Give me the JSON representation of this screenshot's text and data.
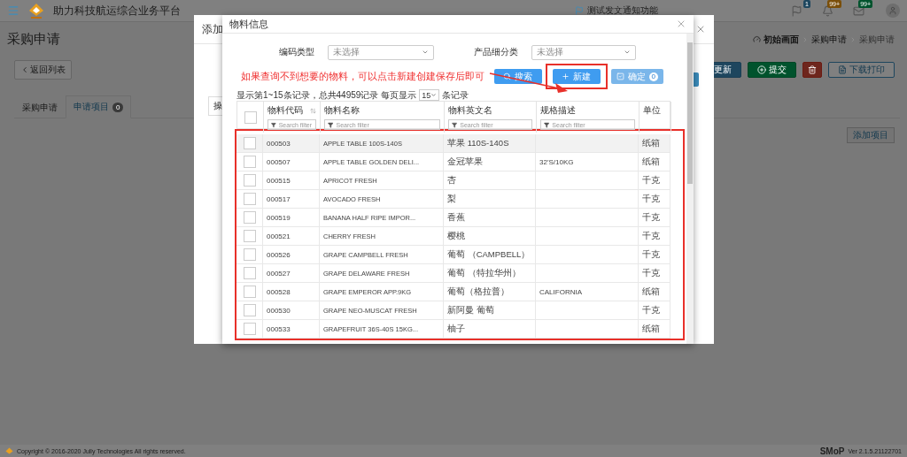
{
  "header": {
    "title": "助力科技航运综合业务平台",
    "notice": "测试发文通知功能",
    "icons": [
      {
        "kind": "flag",
        "badge": "1",
        "color": "#1e465e"
      },
      {
        "kind": "bell",
        "badge": "99+",
        "color": "#7a4e09"
      },
      {
        "kind": "mail",
        "badge": "99+",
        "color": "#00532d"
      }
    ]
  },
  "page": {
    "title": "采购申请",
    "breadcrumb": [
      "初始画面",
      "采购申请",
      "采购申请"
    ],
    "back_button": "返回列表",
    "actions": [
      {
        "kind": "update",
        "label": "更新"
      },
      {
        "kind": "submit",
        "label": "提交"
      },
      {
        "kind": "delete"
      },
      {
        "kind": "print",
        "label": "下载打印"
      }
    ],
    "tabs": [
      {
        "label": "采购申请",
        "selected": false
      },
      {
        "label": "申请项目",
        "badge": "0",
        "selected": true
      }
    ],
    "add_button": "添加项目"
  },
  "back_modal": {
    "title": "添加",
    "column_label": "操"
  },
  "modal": {
    "title": "物料信息",
    "filters": [
      {
        "label": "编码类型",
        "placeholder": "未选择"
      },
      {
        "label": "产品细分类",
        "placeholder": "未选择"
      }
    ],
    "annotation": "如果查询不到想要的物料，可以点击新建创建保存后即可",
    "buttons": [
      {
        "kind": "search",
        "label": "搜索",
        "disabled": false,
        "highlighted": false
      },
      {
        "kind": "new",
        "label": "新建",
        "disabled": false,
        "highlighted": true
      },
      {
        "kind": "confirm",
        "label": "确定",
        "badge": "0",
        "disabled": true,
        "highlighted": false
      }
    ],
    "info": {
      "prefix": "显示第1~15条记录，总共44959记录 每页显示",
      "page_size": "15",
      "suffix": "条记录"
    },
    "table": {
      "all_checked": false,
      "rows_highlighted": true,
      "columns": [
        {
          "label": "物料代码",
          "sortable": true,
          "filter_placeholder": "Search filter"
        },
        {
          "label": "物料名称",
          "sortable": false,
          "filter_placeholder": "Search filter"
        },
        {
          "label": "物料英文名",
          "sortable": false,
          "filter_placeholder": "Search filter"
        },
        {
          "label": "规格描述",
          "sortable": false,
          "filter_placeholder": "Search filter"
        },
        {
          "label": "单位",
          "sortable": false
        }
      ],
      "rows": [
        {
          "cells": [
            "000503",
            "APPLE TABLE 100S-140S",
            "苹果 110S-140S",
            "",
            "纸箱"
          ],
          "checked": false,
          "hovered": true
        },
        {
          "cells": [
            "000507",
            "APPLE TABLE GOLDEN DELI...",
            "金冠苹果",
            "32'S/10KG",
            "纸箱"
          ],
          "checked": false,
          "hovered": false
        },
        {
          "cells": [
            "000515",
            "APRICOT FRESH",
            "杏",
            "",
            "千克"
          ],
          "checked": false,
          "hovered": false
        },
        {
          "cells": [
            "000517",
            "AVOCADO FRESH",
            "梨",
            "",
            "千克"
          ],
          "checked": false,
          "hovered": false
        },
        {
          "cells": [
            "000519",
            "BANANA HALF RIPE IMPOR...",
            "香蕉",
            "",
            "千克"
          ],
          "checked": false,
          "hovered": false
        },
        {
          "cells": [
            "000521",
            "CHERRY FRESH",
            "樱桃",
            "",
            "千克"
          ],
          "checked": false,
          "hovered": false
        },
        {
          "cells": [
            "000526",
            "GRAPE CAMPBELL FRESH",
            "葡萄 （CAMPBELL）",
            "",
            "千克"
          ],
          "checked": false,
          "hovered": false
        },
        {
          "cells": [
            "000527",
            "GRAPE DELAWARE FRESH",
            "葡萄 （特拉华州）",
            "",
            "千克"
          ],
          "checked": false,
          "hovered": false
        },
        {
          "cells": [
            "000528",
            "GRAPE EMPEROR APP.9KG",
            "葡萄（格拉普）",
            "CALIFORNIA",
            "纸箱"
          ],
          "checked": false,
          "hovered": false
        },
        {
          "cells": [
            "000530",
            "GRAPE NEO-MUSCAT FRESH",
            "新阿曼 葡萄",
            "",
            "千克"
          ],
          "checked": false,
          "hovered": false
        },
        {
          "cells": [
            "000533",
            "GRAPEFRUIT 36S-40S 15KG...",
            "柚子",
            "",
            "纸箱"
          ],
          "checked": false,
          "hovered": false
        }
      ]
    }
  },
  "footer": {
    "copyright": "Copyright © 2016-2020 Jully Technologies All rights reserved.",
    "brand": "SMoP",
    "version": "Ver 2.1.5.21122701"
  }
}
